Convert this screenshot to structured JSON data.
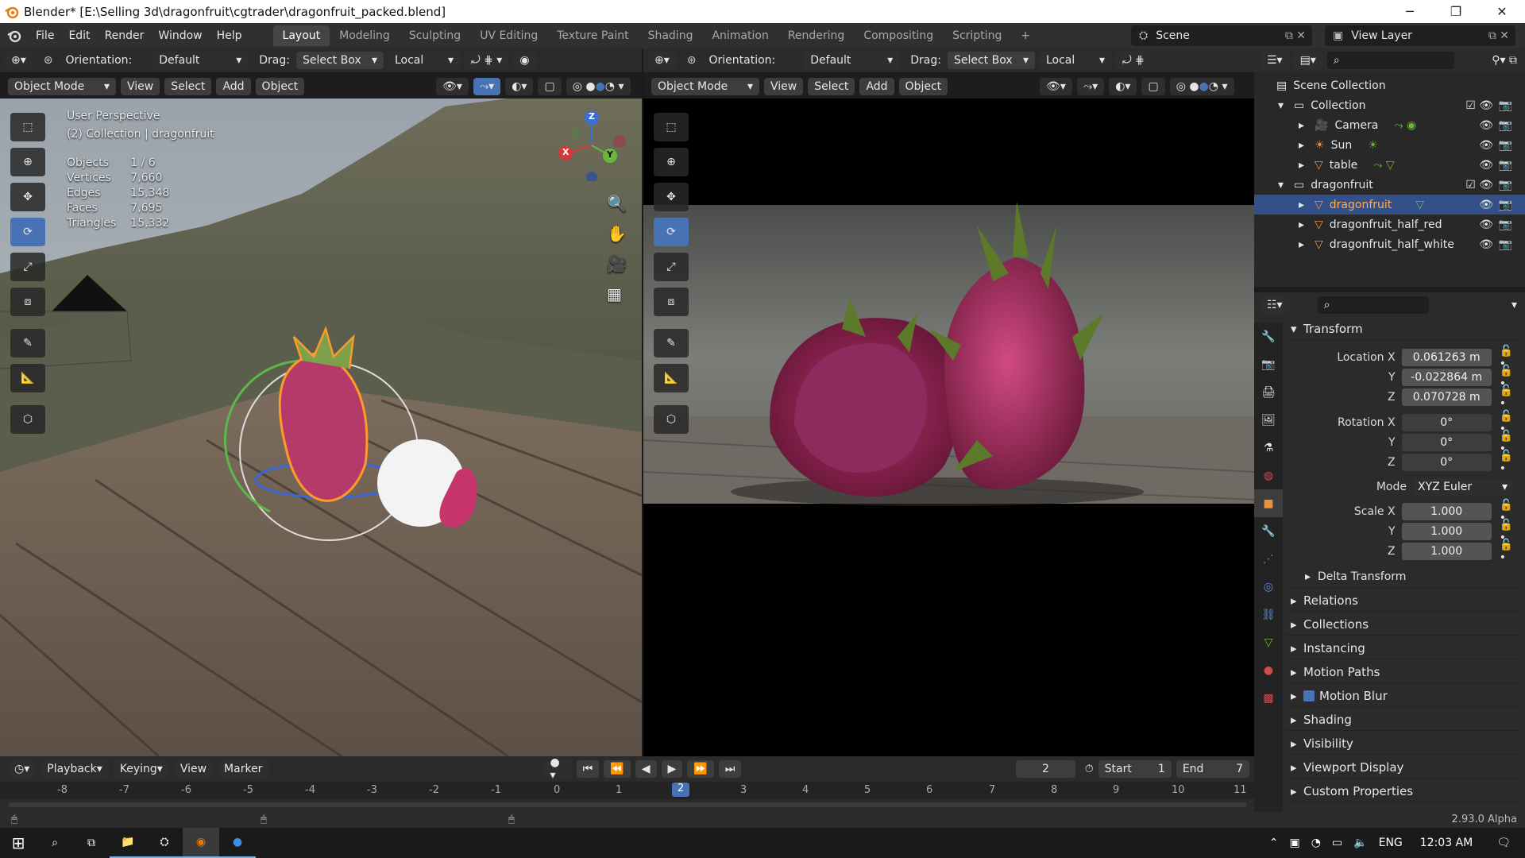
{
  "window": {
    "title": "Blender* [E:\\Selling 3d\\dragonfruit\\cgtrader\\dragonfruit_packed.blend]"
  },
  "menu": [
    "File",
    "Edit",
    "Render",
    "Window",
    "Help"
  ],
  "workspaces": [
    "Layout",
    "Modeling",
    "Sculpting",
    "UV Editing",
    "Texture Paint",
    "Shading",
    "Animation",
    "Rendering",
    "Compositing",
    "Scripting"
  ],
  "active_workspace": "Layout",
  "scene": "Scene",
  "view_layer": "View Layer",
  "viewport_left": {
    "orientation_label": "Orientation:",
    "orientation": "Default",
    "drag_label": "Drag:",
    "drag": "Select Box",
    "pivot": "Local",
    "mode": "Object Mode",
    "menus": [
      "View",
      "Select",
      "Add",
      "Object"
    ],
    "perspective": "User Perspective",
    "collection_info": "(2) Collection | dragonfruit",
    "stats": [
      {
        "label": "Objects",
        "value": "1 / 6"
      },
      {
        "label": "Vertices",
        "value": "7,660"
      },
      {
        "label": "Edges",
        "value": "15,348"
      },
      {
        "label": "Faces",
        "value": "7,695"
      },
      {
        "label": "Triangles",
        "value": "15,332"
      }
    ],
    "gizmo": {
      "x": "X",
      "y": "Y",
      "z": "Z"
    }
  },
  "viewport_right": {
    "orientation_label": "Orientation:",
    "orientation": "Default",
    "drag_label": "Drag:",
    "drag": "Select Box",
    "pivot": "Local",
    "mode": "Object Mode",
    "menus": [
      "View",
      "Select",
      "Add",
      "Object"
    ]
  },
  "outliner": {
    "root": "Scene Collection",
    "items": [
      {
        "label": "Collection",
        "depth": 1,
        "type": "collection"
      },
      {
        "label": "Camera",
        "depth": 2,
        "type": "camera"
      },
      {
        "label": "Sun",
        "depth": 2,
        "type": "light"
      },
      {
        "label": "table",
        "depth": 2,
        "type": "mesh"
      },
      {
        "label": "dragonfruit",
        "depth": 1,
        "type": "collection"
      },
      {
        "label": "dragonfruit",
        "depth": 2,
        "type": "mesh",
        "selected": true
      },
      {
        "label": "dragonfruit_half_red",
        "depth": 2,
        "type": "mesh"
      },
      {
        "label": "dragonfruit_half_white",
        "depth": 2,
        "type": "mesh"
      }
    ]
  },
  "properties": {
    "transform_title": "Transform",
    "location": {
      "x_label": "Location X",
      "y_label": "Y",
      "z_label": "Z",
      "x": "0.061263 m",
      "y": "-0.022864 m",
      "z": "0.070728 m"
    },
    "rotation": {
      "x_label": "Rotation X",
      "y_label": "Y",
      "z_label": "Z",
      "x": "0°",
      "y": "0°",
      "z": "0°"
    },
    "mode_label": "Mode",
    "mode": "XYZ Euler",
    "scale": {
      "x_label": "Scale X",
      "y_label": "Y",
      "z_label": "Z",
      "x": "1.000",
      "y": "1.000",
      "z": "1.000"
    },
    "delta": "Delta Transform",
    "panels": [
      "Relations",
      "Collections",
      "Instancing",
      "Motion Paths",
      "Motion Blur",
      "Shading",
      "Visibility",
      "Viewport Display",
      "Custom Properties"
    ]
  },
  "timeline": {
    "menus": [
      "Playback",
      "Keying",
      "View",
      "Marker"
    ],
    "current_frame": "2",
    "start_label": "Start",
    "start": "1",
    "end_label": "End",
    "end": "7",
    "ticks": [
      "-8",
      "-7",
      "-6",
      "-5",
      "-4",
      "-3",
      "-2",
      "-1",
      "0",
      "1",
      "2",
      "3",
      "4",
      "5",
      "6",
      "7",
      "8",
      "9",
      "10",
      "11"
    ]
  },
  "status": {
    "version": "2.93.0 Alpha"
  },
  "taskbar": {
    "lang": "ENG",
    "time": "12:03 AM"
  },
  "colors": {
    "accent": "#4772b3",
    "selected_row": "#33508a",
    "header": "#2b2b2b"
  }
}
